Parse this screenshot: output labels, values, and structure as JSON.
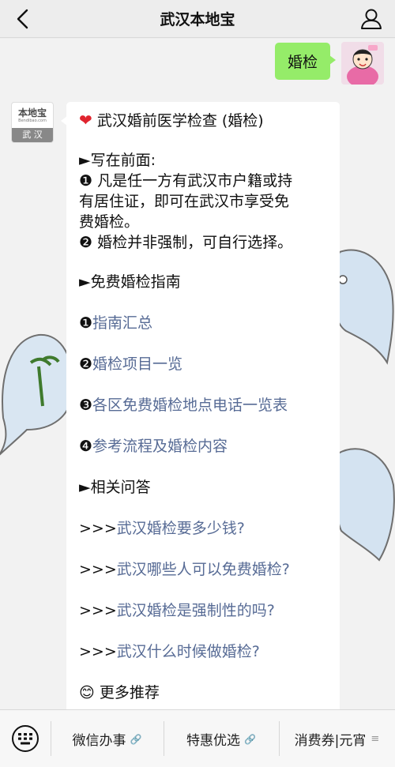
{
  "header": {
    "title": "武汉本地宝",
    "back_icon": "chevron-left-icon",
    "profile_icon": "person-icon"
  },
  "user_message": {
    "text": "婚检"
  },
  "bot": {
    "avatar_logo": "本地宝",
    "avatar_sub": "Bendibao.com",
    "avatar_tag": "武 汉"
  },
  "message": {
    "title": "武汉婚前医学检查 (婚检)",
    "preface_heading": "►写在前面:",
    "preface_1_lines": [
      "❶ 凡是任一方有武汉市户籍或持",
      "有居住证，即可在武汉市享受免",
      "费婚检。"
    ],
    "preface_2": "❷ 婚检并非强制，可自行选择。",
    "guide_heading": "►免费婚检指南",
    "guide_items": [
      {
        "num": "❶",
        "text": "指南汇总"
      },
      {
        "num": "❷",
        "text": "婚检项目一览"
      },
      {
        "num": "❸",
        "text": "各区免费婚检地点电话一览表"
      },
      {
        "num": "❹",
        "text": "参考流程及婚检内容"
      }
    ],
    "qa_heading": "►相关问答",
    "qa_items": [
      {
        "prefix": ">>>",
        "text": "武汉婚检要多少钱?"
      },
      {
        "prefix": ">>>",
        "text": "武汉哪些人可以免费婚检?"
      },
      {
        "prefix": ">>>",
        "text": "武汉婚检是强制性的吗?"
      },
      {
        "prefix": ">>>",
        "text": "武汉什么时候做婚检?"
      }
    ],
    "cutoff_text": "更多推荐"
  },
  "menu": {
    "items": [
      {
        "label": "微信办事"
      },
      {
        "label": "特惠优选"
      },
      {
        "label": "消费券|元宵"
      }
    ],
    "link_glyph": "🔗",
    "hamburger_glyph": "≡"
  },
  "colors": {
    "link": "#576b95",
    "user_bubble": "#95ec69",
    "heart": "#e0242e"
  }
}
